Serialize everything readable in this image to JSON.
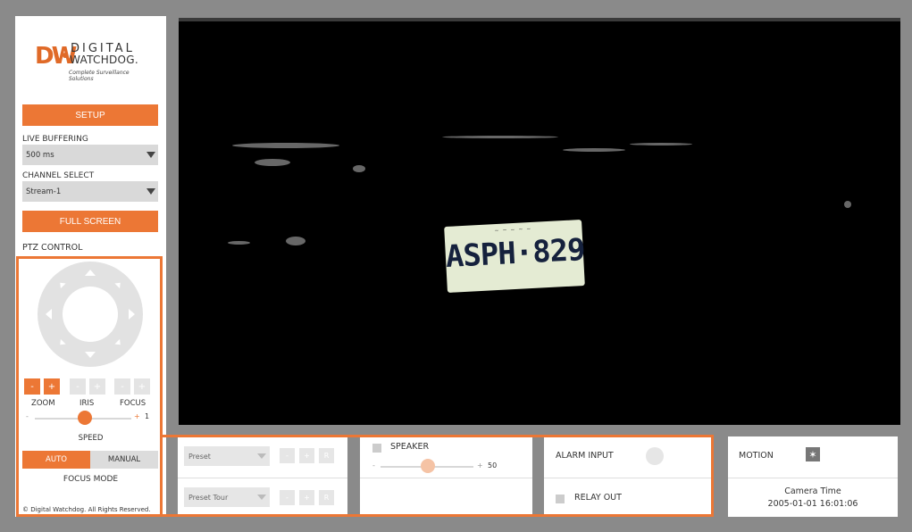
{
  "logo": {
    "brand_mark": "DW",
    "line1": "DIGITAL",
    "line2": "WATCHDOG.",
    "tagline": "Complete Surveillance Solutions"
  },
  "sidebar": {
    "setup_label": "SETUP",
    "live_buffering_label": "LIVE BUFFERING",
    "live_buffering_value": "500 ms",
    "channel_select_label": "CHANNEL SELECT",
    "channel_select_value": "Stream-1",
    "full_screen_label": "FULL SCREEN",
    "ptz_control_label": "PTZ CONTROL",
    "zoom_label": "ZOOM",
    "iris_label": "IRIS",
    "focus_label": "FOCUS",
    "minus": "-",
    "plus": "+",
    "speed_label": "SPEED",
    "speed_value": "1",
    "auto_label": "AUTO",
    "manual_label": "MANUAL",
    "focus_mode_label": "FOCUS MODE",
    "copyright": "© Digital Watchdog. All Rights Reserved."
  },
  "video": {
    "plate_header": "~ ~ ~ ~ ~",
    "plate_text": "ASPH·829"
  },
  "preset": {
    "preset_value": "Preset",
    "preset_tour_value": "Preset Tour",
    "btn_minus": "-",
    "btn_plus": "+",
    "btn_r": "R"
  },
  "audio": {
    "speaker_label": "SPEAKER",
    "volume_value": "50",
    "minus": "-",
    "plus": "+"
  },
  "io": {
    "alarm_input_label": "ALARM INPUT",
    "relay_out_label": "RELAY OUT"
  },
  "status": {
    "motion_label": "MOTION",
    "camera_time_label": "Camera Time",
    "camera_time_value": "2005-01-01 16:01:06"
  },
  "colors": {
    "accent": "#ec7735",
    "background": "#8a8a8a"
  }
}
